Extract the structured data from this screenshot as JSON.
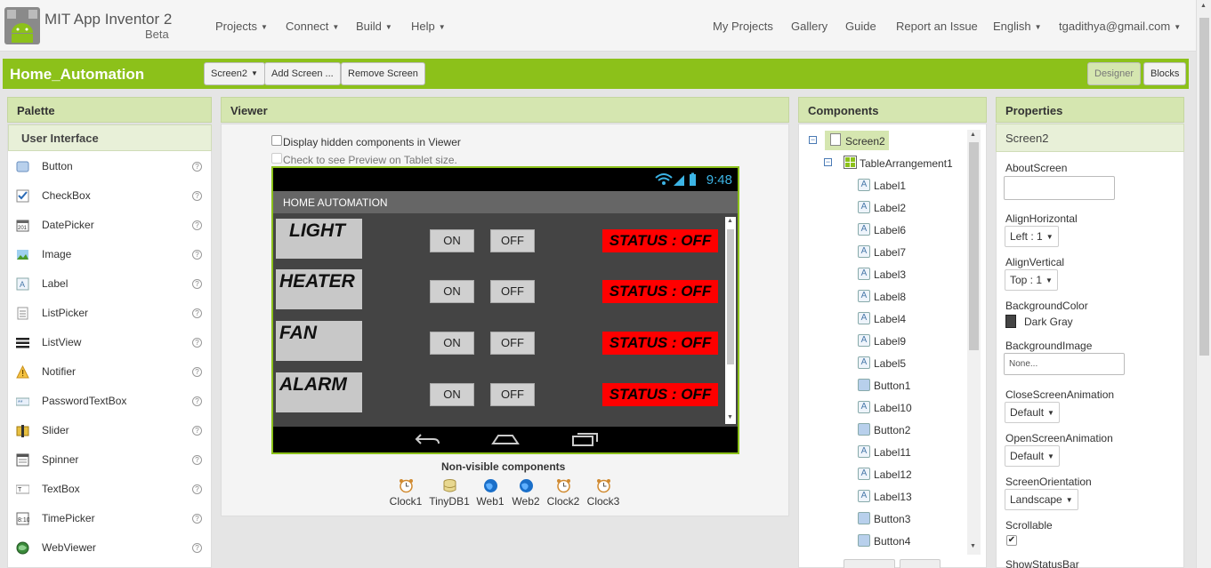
{
  "header": {
    "app_title": "MIT App Inventor 2",
    "beta": "Beta",
    "menus": [
      "Projects",
      "Connect",
      "Build",
      "Help"
    ],
    "right_links": [
      "My Projects",
      "Gallery",
      "Guide",
      "Report an Issue"
    ],
    "language": "English",
    "user": "tgadithya@gmail.com"
  },
  "toolbar": {
    "project_name": "Home_Automation",
    "screen_select": "Screen2",
    "add_screen": "Add Screen ...",
    "remove_screen": "Remove Screen",
    "designer": "Designer",
    "blocks": "Blocks"
  },
  "palette": {
    "title": "Palette",
    "category": "User Interface",
    "items": [
      {
        "label": "Button",
        "icon": "button-icon"
      },
      {
        "label": "CheckBox",
        "icon": "checkbox-icon"
      },
      {
        "label": "DatePicker",
        "icon": "datepicker-icon"
      },
      {
        "label": "Image",
        "icon": "image-icon"
      },
      {
        "label": "Label",
        "icon": "label-icon"
      },
      {
        "label": "ListPicker",
        "icon": "listpicker-icon"
      },
      {
        "label": "ListView",
        "icon": "listview-icon"
      },
      {
        "label": "Notifier",
        "icon": "notifier-icon"
      },
      {
        "label": "PasswordTextBox",
        "icon": "passwordtextbox-icon"
      },
      {
        "label": "Slider",
        "icon": "slider-icon"
      },
      {
        "label": "Spinner",
        "icon": "spinner-icon"
      },
      {
        "label": "TextBox",
        "icon": "textbox-icon"
      },
      {
        "label": "TimePicker",
        "icon": "timepicker-icon"
      },
      {
        "label": "WebViewer",
        "icon": "webviewer-icon"
      }
    ],
    "help_glyph": "?"
  },
  "viewer": {
    "title": "Viewer",
    "check_hidden": "Display hidden components in Viewer",
    "check_tablet": "Check to see Preview on Tablet size.",
    "phone": {
      "clock": "9:48",
      "app_title": "HOME AUTOMATION",
      "rows": [
        {
          "label": "LIGHT",
          "on": "ON",
          "off": "OFF",
          "status": "STATUS : OFF"
        },
        {
          "label": "HEATER",
          "on": "ON",
          "off": "OFF",
          "status": "STATUS : OFF"
        },
        {
          "label": "FAN",
          "on": "ON",
          "off": "OFF",
          "status": "STATUS : OFF"
        },
        {
          "label": "ALARM",
          "on": "ON",
          "off": "OFF",
          "status": "STATUS : OFF"
        }
      ]
    },
    "nonvisible_title": "Non-visible components",
    "nonvisible": [
      "Clock1",
      "TinyDB1",
      "Web1",
      "Web2",
      "Clock2",
      "Clock3"
    ]
  },
  "components": {
    "title": "Components",
    "root": "Screen2",
    "arrangement": "TableArrangement1",
    "children": [
      {
        "label": "Label1",
        "type": "label"
      },
      {
        "label": "Label2",
        "type": "label"
      },
      {
        "label": "Label6",
        "type": "label"
      },
      {
        "label": "Label7",
        "type": "label"
      },
      {
        "label": "Label3",
        "type": "label"
      },
      {
        "label": "Label8",
        "type": "label"
      },
      {
        "label": "Label4",
        "type": "label"
      },
      {
        "label": "Label9",
        "type": "label"
      },
      {
        "label": "Label5",
        "type": "label"
      },
      {
        "label": "Button1",
        "type": "button"
      },
      {
        "label": "Label10",
        "type": "label"
      },
      {
        "label": "Button2",
        "type": "button"
      },
      {
        "label": "Label11",
        "type": "label"
      },
      {
        "label": "Label12",
        "type": "label"
      },
      {
        "label": "Label13",
        "type": "label"
      },
      {
        "label": "Button3",
        "type": "button"
      },
      {
        "label": "Button4",
        "type": "button"
      }
    ]
  },
  "properties": {
    "title": "Properties",
    "component": "Screen2",
    "about_screen_label": "AboutScreen",
    "align_h_label": "AlignHorizontal",
    "align_h_value": "Left : 1",
    "align_v_label": "AlignVertical",
    "align_v_value": "Top : 1",
    "bgcolor_label": "BackgroundColor",
    "bgcolor_value": "Dark Gray",
    "bgimage_label": "BackgroundImage",
    "bgimage_value": "None...",
    "close_anim_label": "CloseScreenAnimation",
    "close_anim_value": "Default",
    "open_anim_label": "OpenScreenAnimation",
    "open_anim_value": "Default",
    "orientation_label": "ScreenOrientation",
    "orientation_value": "Landscape",
    "scrollable_label": "Scrollable",
    "scrollable_checked": true,
    "status_bar_label": "ShowStatusBar"
  },
  "colors": {
    "accent_green": "#8cc11a",
    "panel_header": "#d5e6b0",
    "status_red": "#ff0000",
    "phone_bg": "#444444",
    "clock_blue": "#3cb4e5"
  }
}
